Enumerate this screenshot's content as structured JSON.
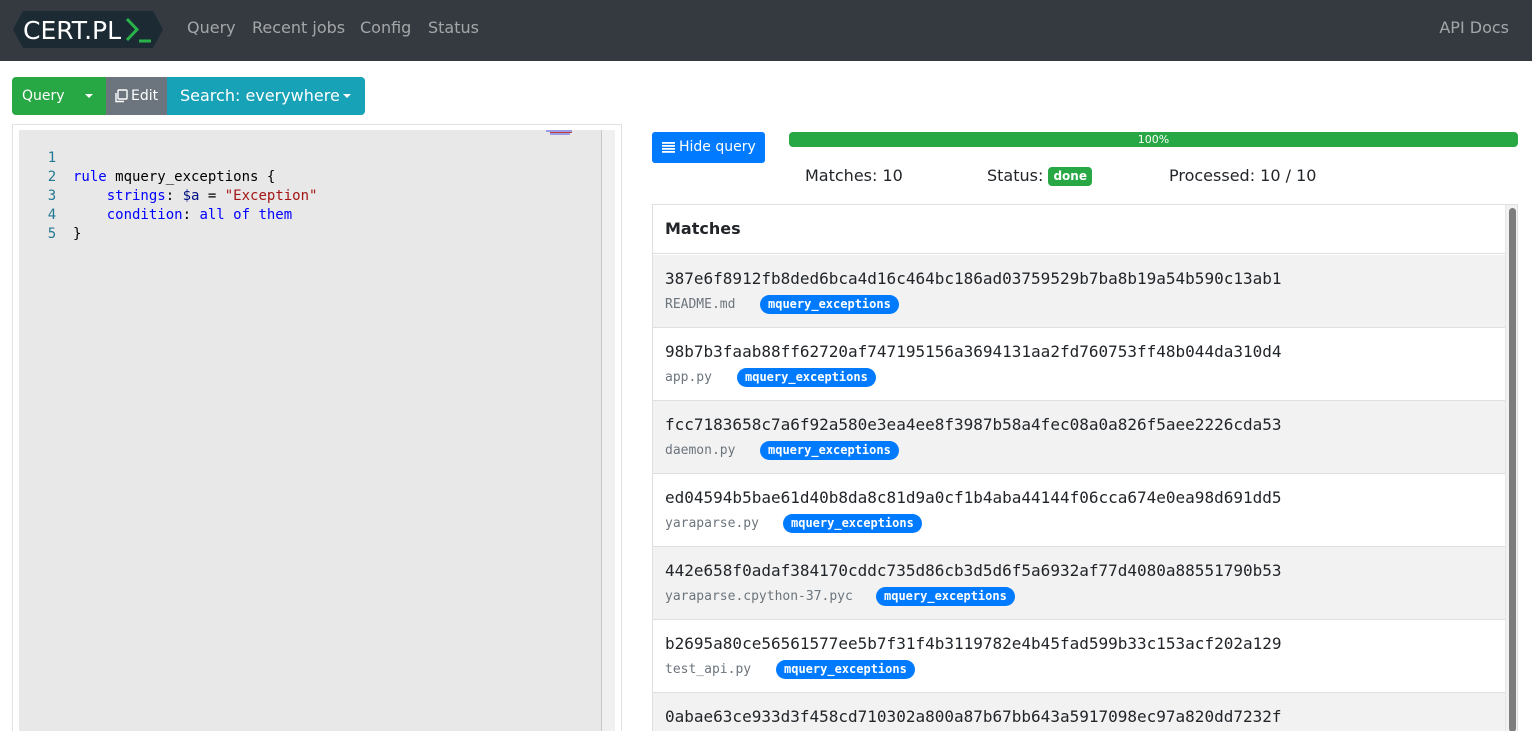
{
  "nav": {
    "brand": "CERT.PL",
    "links": [
      "Query",
      "Recent jobs",
      "Config",
      "Status"
    ],
    "api_docs": "API Docs"
  },
  "toolbar": {
    "query_label": "Query",
    "edit_label": "Edit",
    "search_label": "Search: everywhere"
  },
  "editor": {
    "lines": [
      "1",
      "2",
      "3",
      "4",
      "5"
    ]
  },
  "results": {
    "hide_query_label": "Hide query",
    "progress_text": "100%",
    "progress_percent": 100,
    "matches_text": "Matches: 10",
    "status_label": "Status:",
    "status_value": "done",
    "processed_text": "Processed: 10 / 10",
    "card_title": "Matches",
    "items": [
      {
        "hash": "387e6f8912fb8ded6bca4d16c464bc186ad03759529b7ba8b19a54b590c13ab1",
        "file": "README.md",
        "tag": "mquery_exceptions"
      },
      {
        "hash": "98b7b3faab88ff62720af747195156a3694131aa2fd760753ff48b044da310d4",
        "file": "app.py",
        "tag": "mquery_exceptions"
      },
      {
        "hash": "fcc7183658c7a6f92a580e3ea4ee8f3987b58a4fec08a0a826f5aee2226cda53",
        "file": "daemon.py",
        "tag": "mquery_exceptions"
      },
      {
        "hash": "ed04594b5bae61d40b8da8c81d9a0cf1b4aba44144f06cca674e0ea98d691dd5",
        "file": "yaraparse.py",
        "tag": "mquery_exceptions"
      },
      {
        "hash": "442e658f0adaf384170cddc735d86cb3d5d6f5a6932af77d4080a88551790b53",
        "file": "yaraparse.cpython-37.pyc",
        "tag": "mquery_exceptions"
      },
      {
        "hash": "b2695a80ce56561577ee5b7f31f4b3119782e4b45fad599b33c153acf202a129",
        "file": "test_api.py",
        "tag": "mquery_exceptions"
      },
      {
        "hash": "0abae63ce933d3f458cd710302a800a87b67bb643a5917098ec97a820dd7232f",
        "file": "",
        "tag": ""
      }
    ]
  }
}
